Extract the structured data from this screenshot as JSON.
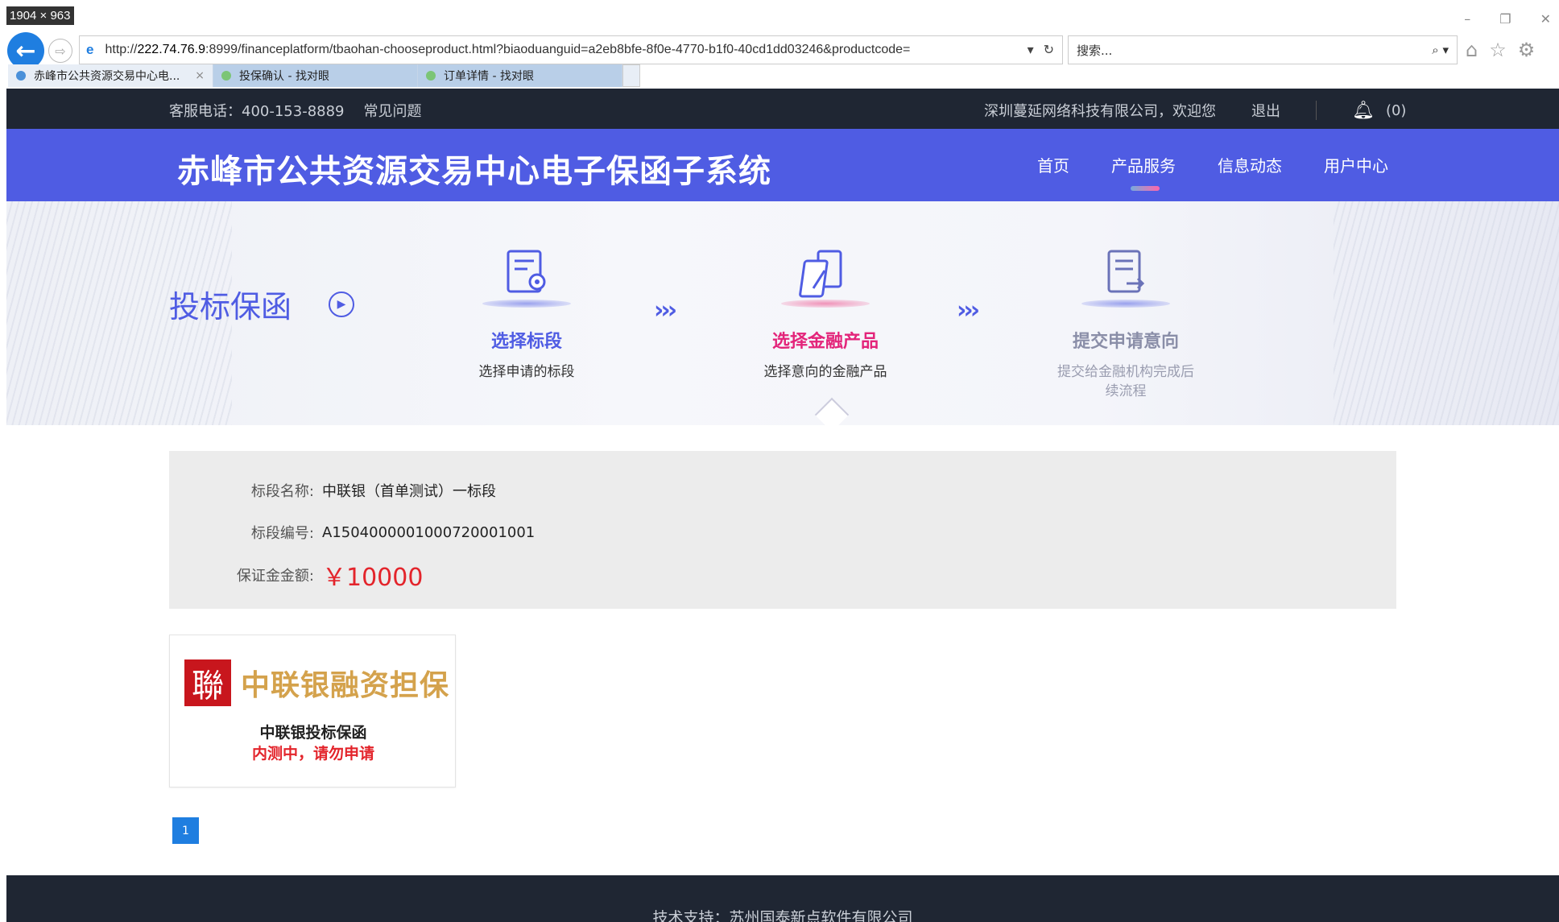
{
  "overlay": {
    "dimensions": "1904 × 963"
  },
  "window_controls": [
    "–",
    "❐",
    "✕"
  ],
  "browser": {
    "url_prefix": "http://",
    "url_host": "222.74.76.9",
    "url_rest": ":8999/financeplatform/tbaohan-chooseproduct.html?biaoduanguid=a2eb8bfe-8f0e-4770-b1f0-40cd1dd03246&productcode=",
    "search_placeholder": "搜索...",
    "tabs": [
      {
        "label": "赤峰市公共资源交易中心电...",
        "active": true,
        "closable": true
      },
      {
        "label": "投保确认 - 找对眼",
        "active": false
      },
      {
        "label": "订单详情 - 找对眼",
        "active": false
      }
    ]
  },
  "topbar": {
    "hotline": "客服电话：400-153-8889",
    "faq": "常见问题",
    "welcome": "深圳蔓延网络科技有限公司，欢迎您",
    "logout": "退出",
    "notify_count": "(0)"
  },
  "header": {
    "title": "赤峰市公共资源交易中心电子保函子系统",
    "nav": [
      {
        "label": "首页",
        "active": false
      },
      {
        "label": "产品服务",
        "active": true
      },
      {
        "label": "信息动态",
        "active": false
      },
      {
        "label": "用户中心",
        "active": false
      }
    ]
  },
  "banner": {
    "label": "投标保函",
    "steps": [
      {
        "name": "选择标段",
        "desc": "选择申请的标段",
        "state": "done"
      },
      {
        "name": "选择金融产品",
        "desc": "选择意向的金融产品",
        "state": "active"
      },
      {
        "name": "提交申请意向",
        "desc": "提交给金融机构完成后续流程",
        "state": "pending"
      }
    ],
    "separator": "›››"
  },
  "info": {
    "section_name_label": "标段名称:",
    "section_name": "中联银（首单测试）一标段",
    "section_no_label": "标段编号:",
    "section_no": "A1504000001000720001001",
    "deposit_label": "保证金金额:",
    "deposit": "￥10000"
  },
  "products": [
    {
      "seal": "聯",
      "brand": "中联银融资担保",
      "name": "中联银投标保函",
      "warning": "内测中，请勿申请"
    }
  ],
  "pagination": {
    "current": "1"
  },
  "footer": {
    "text": "技术支持：苏州国泰新点软件有限公司"
  },
  "colors": {
    "primary": "#4f5ce3",
    "dark_bar": "#1f2633",
    "accent_pink": "#e3247a",
    "price_red": "#e3242b",
    "brand_gold": "#d4a24c"
  }
}
